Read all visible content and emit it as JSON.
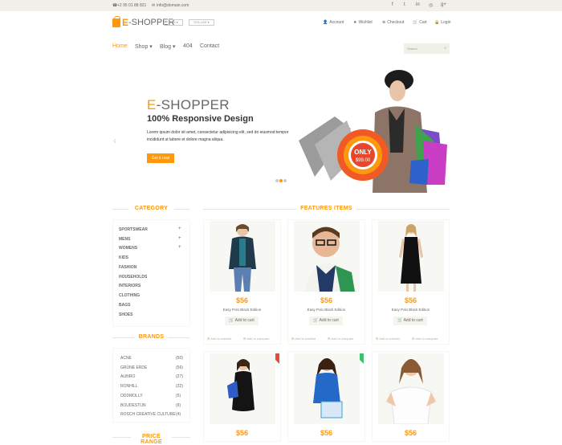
{
  "topbar": {
    "phone": "+2 95 01 88 821",
    "email": "info@domain.com"
  },
  "logo": {
    "e": "E",
    "rest": "-SHOPPER"
  },
  "dropdowns": {
    "currency_country": "USA",
    "currency": "DOLLAR"
  },
  "account_links": [
    "Account",
    "Wishlist",
    "Checkout",
    "Cart",
    "Login"
  ],
  "nav": [
    "Home",
    "Shop",
    "Blog",
    "404",
    "Contact"
  ],
  "search": {
    "placeholder": "Search"
  },
  "hero": {
    "brand_e": "E",
    "brand_rest": "-SHOPPER",
    "headline": "100% Responsive Design",
    "text": "Lorem ipsum dolor sit amet, consectetur adipisicing elit, sed do eiusmod tempor incididunt ut labore et dolore magna aliqua.",
    "button": "Get it now",
    "tag_top": "ONLY",
    "tag_price": "$99.00"
  },
  "sections": {
    "category": "CATEGORY",
    "features": "FEATURES ITEMS",
    "brands": "BRANDS",
    "price_range": "PRICE RANGE"
  },
  "categories": [
    {
      "label": "SPORTSWEAR",
      "expand": "+"
    },
    {
      "label": "MENS",
      "expand": "+"
    },
    {
      "label": "WOMENS",
      "expand": "+"
    },
    {
      "label": "KIDS",
      "expand": ""
    },
    {
      "label": "FASHION",
      "expand": ""
    },
    {
      "label": "HOUSEHOLDS",
      "expand": ""
    },
    {
      "label": "INTERIORS",
      "expand": ""
    },
    {
      "label": "CLOTHING",
      "expand": ""
    },
    {
      "label": "BAGS",
      "expand": ""
    },
    {
      "label": "SHOES",
      "expand": ""
    }
  ],
  "brands": [
    {
      "name": "ACNE",
      "count": "(50)"
    },
    {
      "name": "GRÜNE ERDE",
      "count": "(56)"
    },
    {
      "name": "ALBIRO",
      "count": "(27)"
    },
    {
      "name": "RONHILL",
      "count": "(32)"
    },
    {
      "name": "ODDMOLLY",
      "count": "(5)"
    },
    {
      "name": "BOUDESTIJN",
      "count": "(9)"
    },
    {
      "name": "ROSCH CREATIVE CULTURE",
      "count": "(4)"
    }
  ],
  "products": [
    {
      "price": "$56",
      "name": "Easy Polo Black Edition",
      "cart": "Add to cart",
      "wishlist": "Add to wishlist",
      "compare": "Add to compare"
    },
    {
      "price": "$56",
      "name": "Easy Polo Black Edition",
      "cart": "Add to cart",
      "wishlist": "Add to wishlist",
      "compare": "Add to compare"
    },
    {
      "price": "$56",
      "name": "Easy Polo Black Edition",
      "cart": "Add to cart",
      "wishlist": "Add to wishlist",
      "compare": "Add to compare"
    },
    {
      "price": "$56"
    },
    {
      "price": "$56"
    },
    {
      "price": "$56"
    }
  ],
  "colors": {
    "accent": "#fe980f",
    "topbar_bg": "#f0f0e9",
    "text": "#696763",
    "badge_red": "#e34c3b",
    "badge_green": "#3dbf6f"
  }
}
